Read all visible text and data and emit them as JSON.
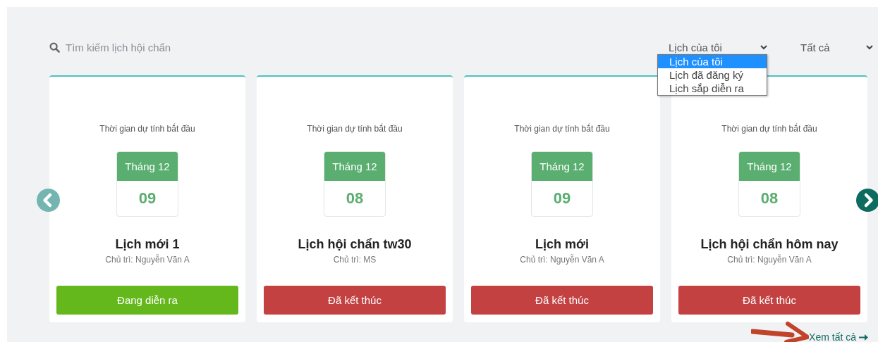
{
  "search": {
    "placeholder": "Tìm kiếm lịch hội chẩn"
  },
  "filters": [
    {
      "value": "Lịch của tôi",
      "expanded": true,
      "options": [
        {
          "label": "Lịch của tôi",
          "selected": true
        },
        {
          "label": "Lịch đã đăng ký",
          "selected": false
        },
        {
          "label": "Lịch sắp diễn ra",
          "selected": false
        }
      ]
    },
    {
      "value": "Tất cả"
    }
  ],
  "cards": [
    {
      "caption": "Thời gian dự tính bắt đầu",
      "month": "Tháng 12",
      "day": "09",
      "title": "Lịch mới 1",
      "host": "Chủ trì: Nguyễn Văn A",
      "status": {
        "kind": "ongoing",
        "label": "Đang diễn ra"
      }
    },
    {
      "caption": "Thời gian dự tính bắt đầu",
      "month": "Tháng 12",
      "day": "08",
      "title": "Lịch hội chẩn tw30",
      "host": "Chủ trì: MS",
      "status": {
        "kind": "ended",
        "label": "Đã kết thúc"
      }
    },
    {
      "caption": "Thời gian dự tính bắt đầu",
      "month": "Tháng 12",
      "day": "09",
      "title": "Lịch mới",
      "host": "Chủ trì: Nguyễn Văn A",
      "status": {
        "kind": "ended",
        "label": "Đã kết thúc"
      }
    },
    {
      "caption": "Thời gian dự tính bắt đầu",
      "month": "Tháng 12",
      "day": "08",
      "title": "Lịch hội chẩn hôm nay",
      "host": "Chủ trì: Nguyễn Văn A",
      "status": {
        "kind": "ended",
        "label": "Đã kết thúc"
      }
    }
  ],
  "view_all": "Xem tất cả"
}
